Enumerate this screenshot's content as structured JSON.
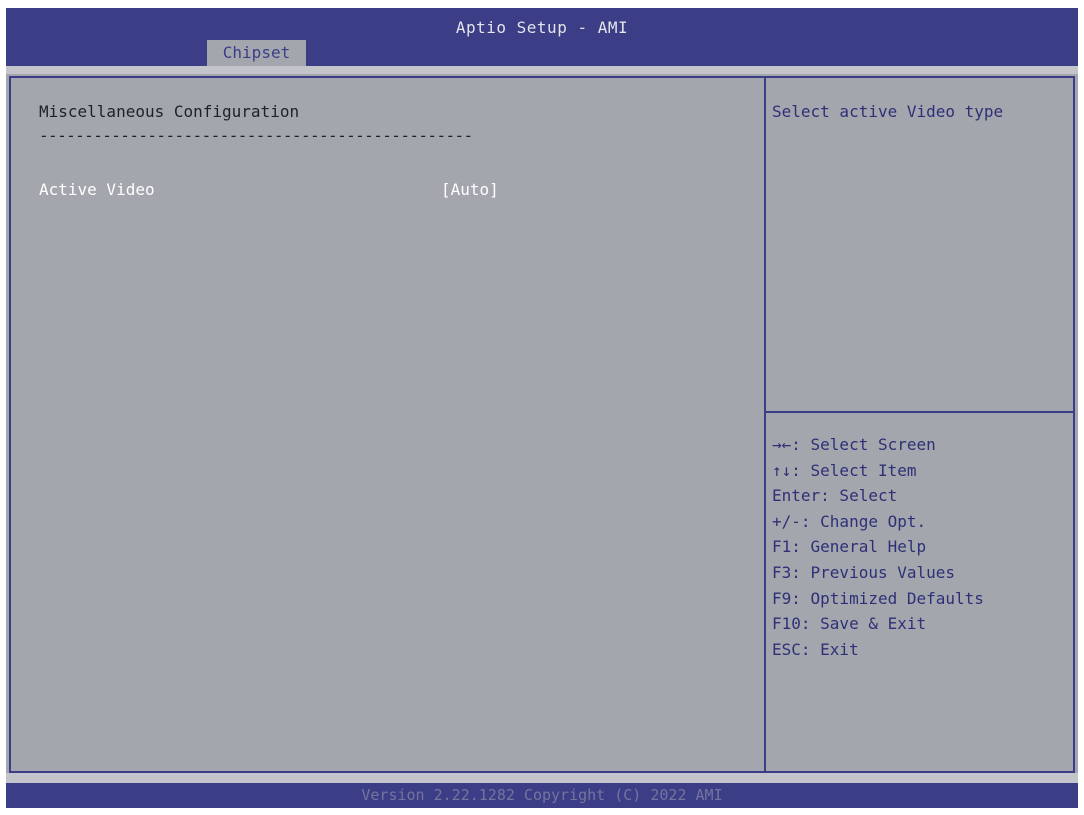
{
  "header": {
    "title": "Aptio Setup - AMI",
    "tabs": [
      {
        "label": "Chipset",
        "active": true
      }
    ]
  },
  "main": {
    "section_title": "Miscellaneous Configuration",
    "divider": "------------------------------------------------",
    "settings": [
      {
        "label": "Active Video",
        "value": "[Auto]",
        "selected": true
      }
    ]
  },
  "help": {
    "text": "Select active Video type",
    "keys": [
      "→←: Select Screen",
      "↑↓: Select Item",
      "Enter: Select",
      "+/-: Change Opt.",
      "F1: General Help",
      "F3: Previous Values",
      "F9: Optimized Defaults",
      "F10: Save & Exit",
      "ESC: Exit"
    ]
  },
  "footer": {
    "text": "Version 2.22.1282 Copyright (C) 2022 AMI"
  },
  "colors": {
    "frame_blue": "#3b3d86",
    "panel_gray": "#a4a6ad",
    "selected_text": "#ffffff",
    "help_text": "#2e3077"
  }
}
